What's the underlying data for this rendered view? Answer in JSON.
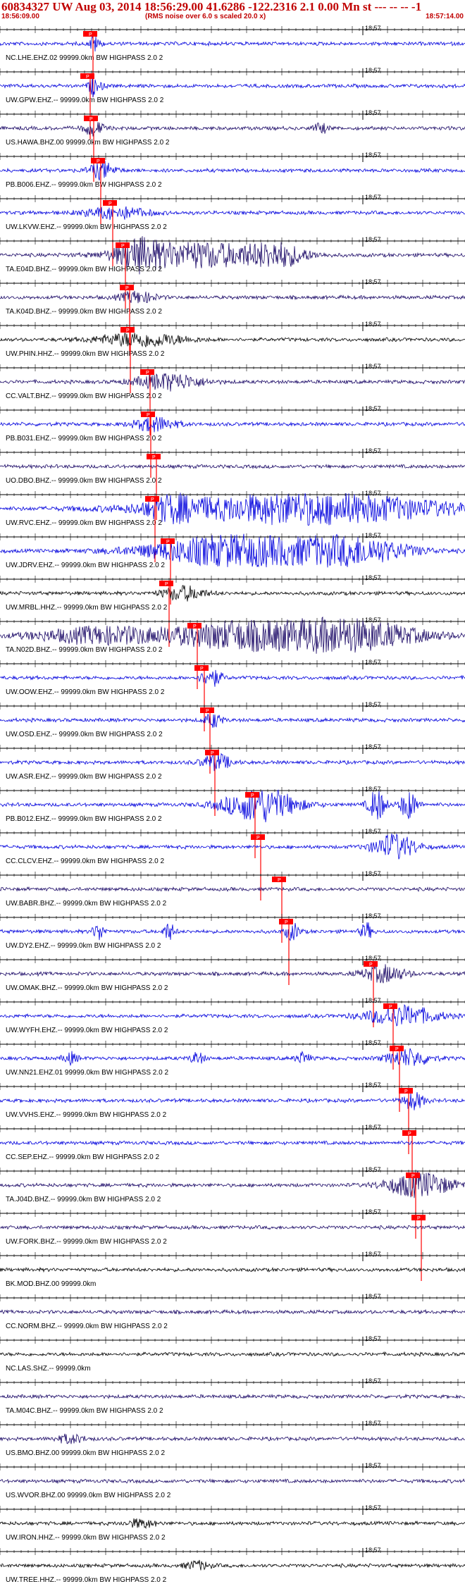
{
  "header": {
    "title": "60834327 UW Aug 03, 2014 18:56:29.00   41.6286 -122.2316  2.1 0.00 Mn st --- -- --   -1",
    "start_time": "18:56:09.00",
    "rms_note": "(RMS noise over 6.0 s scaled 20.0 x)",
    "end_time": "18:57:14.00"
  },
  "tick_label": "18:57",
  "pick_label": "P",
  "colors": {
    "blue": "#0000dd",
    "dark": "#1a0866",
    "black": "#000000",
    "red": "#ff0000"
  },
  "traces": [
    {
      "label": "NC.LHE.EHZ.02 99999.0km BW  HIGHPASS  2.0  2",
      "color": "blue",
      "pick": 132,
      "events": [
        [
          132,
          12,
          4
        ],
        [
          138,
          5,
          8
        ]
      ]
    },
    {
      "label": "UW.GPW.EHZ.-- 99999.0km BW  HIGHPASS  2.0  2",
      "color": "blue",
      "pick": 128,
      "events": [
        [
          131,
          12,
          5
        ],
        [
          140,
          4,
          10
        ]
      ]
    },
    {
      "label": "US.HAWA.BHZ.00 99999.0km BW  HIGHPASS  2.0  2",
      "color": "dark",
      "pick": 133,
      "events": [
        [
          133,
          10,
          14
        ],
        [
          455,
          7,
          10
        ]
      ]
    },
    {
      "label": "PB.B006.EHZ.-- 99999.0km BW  HIGHPASS  2.0  2",
      "color": "blue",
      "pick": 143,
      "events": [
        [
          145,
          12,
          18
        ]
      ]
    },
    {
      "label": "UW.LKVW.EHZ.-- 99999.0km BW  HIGHPASS  2.0  2",
      "color": "blue",
      "pick": 160,
      "events": [
        [
          165,
          8,
          45
        ]
      ]
    },
    {
      "label": "TA.E04D.BHZ.-- 99999.0km BW  HIGHPASS  2.0  2",
      "color": "dark",
      "pick": 178,
      "events": [
        [
          195,
          17,
          30
        ],
        [
          280,
          18,
          95
        ],
        [
          395,
          14,
          40
        ]
      ]
    },
    {
      "label": "TA.K04D.BHZ.-- 99999.0km BW  HIGHPASS  2.0  2",
      "color": "dark",
      "pick": 184,
      "events": [
        [
          195,
          8,
          25
        ]
      ]
    },
    {
      "label": "UW.PHIN.HHZ.-- 99999.0km BW  HIGHPASS  2.0  2",
      "color": "black",
      "pick": 185,
      "events": [
        [
          200,
          10,
          60
        ]
      ]
    },
    {
      "label": "CC.VALT.BHZ.-- 99999.0km BW  HIGHPASS  2.0  2",
      "color": "dark",
      "pick": 213,
      "events": [
        [
          240,
          12,
          45
        ]
      ]
    },
    {
      "label": "PB.B031.EHZ.-- 99999.0km BW  HIGHPASS  2.0  2",
      "color": "blue",
      "pick": 214,
      "events": [
        [
          220,
          10,
          30
        ]
      ]
    },
    {
      "label": "UO.DBO.BHZ.-- 99999.0km BW  HIGHPASS  2.0  2",
      "color": "dark",
      "pick": 222,
      "events": []
    },
    {
      "label": "UW.RVC.EHZ.-- 99999.0km BW  HIGHPASS  2.0  2",
      "color": "blue",
      "pick": 220,
      "events": [
        [
          245,
          12,
          35
        ],
        [
          440,
          22,
          200
        ]
      ]
    },
    {
      "label": "UW.JDRV.EHZ.-- 99999.0km BW  HIGHPASS  2.0  2",
      "color": "blue",
      "pick": 242,
      "events": [
        [
          330,
          22,
          120
        ],
        [
          500,
          18,
          80
        ]
      ]
    },
    {
      "label": "UW.MRBL.HHZ.-- 99999.0km BW  HIGHPASS  2.0  2",
      "color": "black",
      "pick": 240,
      "events": [
        [
          260,
          10,
          30
        ]
      ]
    },
    {
      "label": "TA.N02D.BHZ.-- 99999.0km BW  HIGHPASS  2.0  2",
      "color": "dark",
      "pick": 280,
      "events": [
        [
          150,
          12,
          100
        ],
        [
          325,
          16,
          80
        ],
        [
          480,
          24,
          110
        ]
      ]
    },
    {
      "label": "UW.OOW.EHZ.-- 99999.0km BW  HIGHPASS  2.0  2",
      "color": "blue",
      "pick": 290,
      "events": [
        [
          300,
          12,
          15
        ]
      ]
    },
    {
      "label": "UW.OSD.EHZ.-- 99999.0km BW  HIGHPASS  2.0  2",
      "color": "blue",
      "pick": 298,
      "events": [
        [
          303,
          10,
          12
        ]
      ]
    },
    {
      "label": "UW.ASR.EHZ.-- 99999.0km BW  HIGHPASS  2.0  2",
      "color": "blue",
      "pick": 305,
      "events": [
        [
          307,
          12,
          20
        ]
      ]
    },
    {
      "label": "PB.B012.EHZ.-- 99999.0km BW  HIGHPASS  2.0  2",
      "color": "blue",
      "pick": 362,
      "events": [
        [
          370,
          24,
          50
        ],
        [
          535,
          22,
          12
        ],
        [
          580,
          20,
          12
        ]
      ]
    },
    {
      "label": "CC.CLCV.EHZ.-- 99999.0km BW  HIGHPASS  2.0  2",
      "color": "blue",
      "pick": 370,
      "events": [
        [
          560,
          18,
          30
        ]
      ]
    },
    {
      "label": "UW.BABR.BHZ.-- 99999.0km BW  HIGHPASS  2.0  2",
      "color": "dark",
      "pick": 400,
      "events": []
    },
    {
      "label": "UW.DY2.EHZ.-- 99999.0km BW  HIGHPASS  2.0  2",
      "color": "blue",
      "pick": 410,
      "events": [
        [
          140,
          12,
          8
        ],
        [
          240,
          12,
          8
        ],
        [
          415,
          12,
          10
        ],
        [
          520,
          12,
          8
        ]
      ]
    },
    {
      "label": "UW.OMAK.BHZ.-- 99999.0km BW  HIGHPASS  2.0  2",
      "color": "dark",
      "pick": 530,
      "events": [
        [
          545,
          12,
          30
        ]
      ]
    },
    {
      "label": "UW.WYFH.EHZ.-- 99999.0km BW  HIGHPASS  2.0  2",
      "color": "blue",
      "pick": 558,
      "events": [
        [
          570,
          14,
          50
        ]
      ]
    },
    {
      "label": "UW.NN21.EHZ.01 99999.0km BW  HIGHPASS  2.0  2",
      "color": "blue",
      "pick": 567,
      "events": [
        [
          580,
          12,
          30
        ],
        [
          100,
          8,
          10
        ],
        [
          280,
          8,
          10
        ],
        [
          430,
          8,
          10
        ]
      ]
    },
    {
      "label": "UW.VVHS.EHZ.-- 99999.0km BW  HIGHPASS  2.0  2",
      "color": "blue",
      "pick": 580,
      "events": [
        [
          587,
          12,
          15
        ]
      ]
    },
    {
      "label": "CC.SEP.EHZ.-- 99999.0km BW  HIGHPASS  2.0  2",
      "color": "blue",
      "pick": 585,
      "events": []
    },
    {
      "label": "TA.J04D.BHZ.-- 99999.0km BW  HIGHPASS  2.0  2",
      "color": "dark",
      "pick": 590,
      "events": [
        [
          595,
          18,
          45
        ]
      ]
    },
    {
      "label": "UW.FORK.BHZ.-- 99999.0km BW  HIGHPASS  2.0  2",
      "color": "dark",
      "pick": 598,
      "events": []
    },
    {
      "label": "BK.MOD.BHZ.00 99999.0km",
      "color": "black",
      "pick": null,
      "events": []
    },
    {
      "label": "CC.NORM.BHZ.-- 99999.0km BW  HIGHPASS  2.0  2",
      "color": "dark",
      "pick": null,
      "events": []
    },
    {
      "label": "NC.LAS.SHZ.-- 99999.0km",
      "color": "black",
      "pick": null,
      "events": []
    },
    {
      "label": "TA.M04C.BHZ.-- 99999.0km BW  HIGHPASS  2.0  2",
      "color": "dark",
      "pick": null,
      "events": []
    },
    {
      "label": "US.BMO.BHZ.00 99999.0km BW  HIGHPASS  2.0  2",
      "color": "dark",
      "pick": null,
      "events": [
        [
          100,
          6,
          20
        ]
      ]
    },
    {
      "label": "US.WVOR.BHZ.00 99999.0km BW  HIGHPASS  2.0  2",
      "color": "dark",
      "pick": null,
      "events": []
    },
    {
      "label": "UW.IRON.HHZ.-- 99999.0km BW  HIGHPASS  2.0  2",
      "color": "black",
      "pick": null,
      "events": [
        [
          200,
          6,
          20
        ]
      ]
    },
    {
      "label": "UW.TREE.HHZ.-- 99999.0km BW  HIGHPASS  2.0  2",
      "color": "black",
      "pick": null,
      "events": [
        [
          280,
          6,
          18
        ]
      ]
    }
  ]
}
